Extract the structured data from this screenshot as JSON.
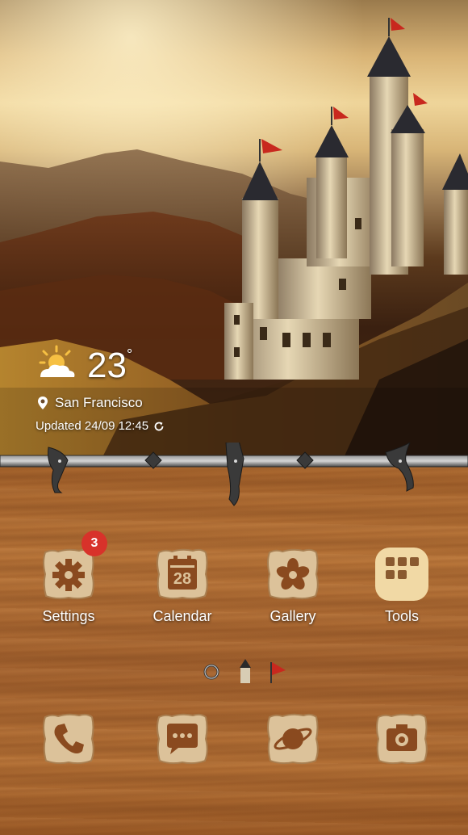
{
  "weather": {
    "temperature": "23",
    "degree_symbol": "°",
    "location": "San Francisco",
    "updated": "Updated 24/09 12:45",
    "condition_icon": "partly-sunny-icon"
  },
  "apps": {
    "settings": {
      "label": "Settings",
      "badge": "3",
      "icon": "gear-icon"
    },
    "calendar": {
      "label": "Calendar",
      "date": "28",
      "icon": "calendar-icon"
    },
    "gallery": {
      "label": "Gallery",
      "icon": "flower-icon"
    },
    "tools": {
      "label": "Tools",
      "icon": "folder-grid-icon"
    }
  },
  "dock": [
    {
      "icon": "phone-icon"
    },
    {
      "icon": "message-icon"
    },
    {
      "icon": "internet-planet-icon"
    },
    {
      "icon": "camera-icon"
    }
  ],
  "pager": {
    "items": [
      "ring-icon",
      "tower-icon",
      "flag-icon"
    ]
  },
  "colors": {
    "badge": "#d8322a",
    "wood": "#b07036",
    "tile": "#d8bc93",
    "icon_glyph": "#8a4a1f"
  }
}
